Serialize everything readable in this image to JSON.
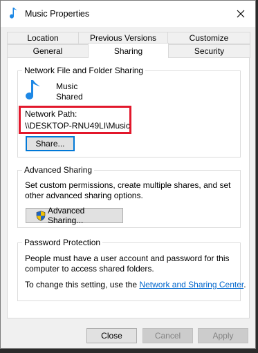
{
  "window": {
    "title": "Music Properties",
    "close_glyph": "✕"
  },
  "tabs": {
    "row_back": [
      "Location",
      "Previous Versions",
      "Customize"
    ],
    "row_front": [
      "General",
      "Sharing",
      "Security"
    ],
    "active": "Sharing"
  },
  "network_sharing": {
    "group_title": "Network File and Folder Sharing",
    "folder_name": "Music",
    "folder_status": "Shared",
    "path_label": "Network Path:",
    "path_value": "\\\\DESKTOP-RNU49LI\\Music",
    "share_button": "Share..."
  },
  "advanced_sharing": {
    "group_title": "Advanced Sharing",
    "description": "Set custom permissions, create multiple shares, and set other advanced sharing options.",
    "button": "Advanced Sharing..."
  },
  "password_protection": {
    "group_title": "Password Protection",
    "description": "People must have a user account and password for this computer to access shared folders.",
    "change_prefix": "To change this setting, use the ",
    "link": "Network and Sharing Center",
    "change_suffix": "."
  },
  "footer": {
    "close": "Close",
    "cancel": "Cancel",
    "apply": "Apply"
  },
  "colors": {
    "highlight_box": "#e2172b",
    "music_icon": "#1e88e5",
    "link": "#0066cc",
    "focus": "#0078d7"
  }
}
